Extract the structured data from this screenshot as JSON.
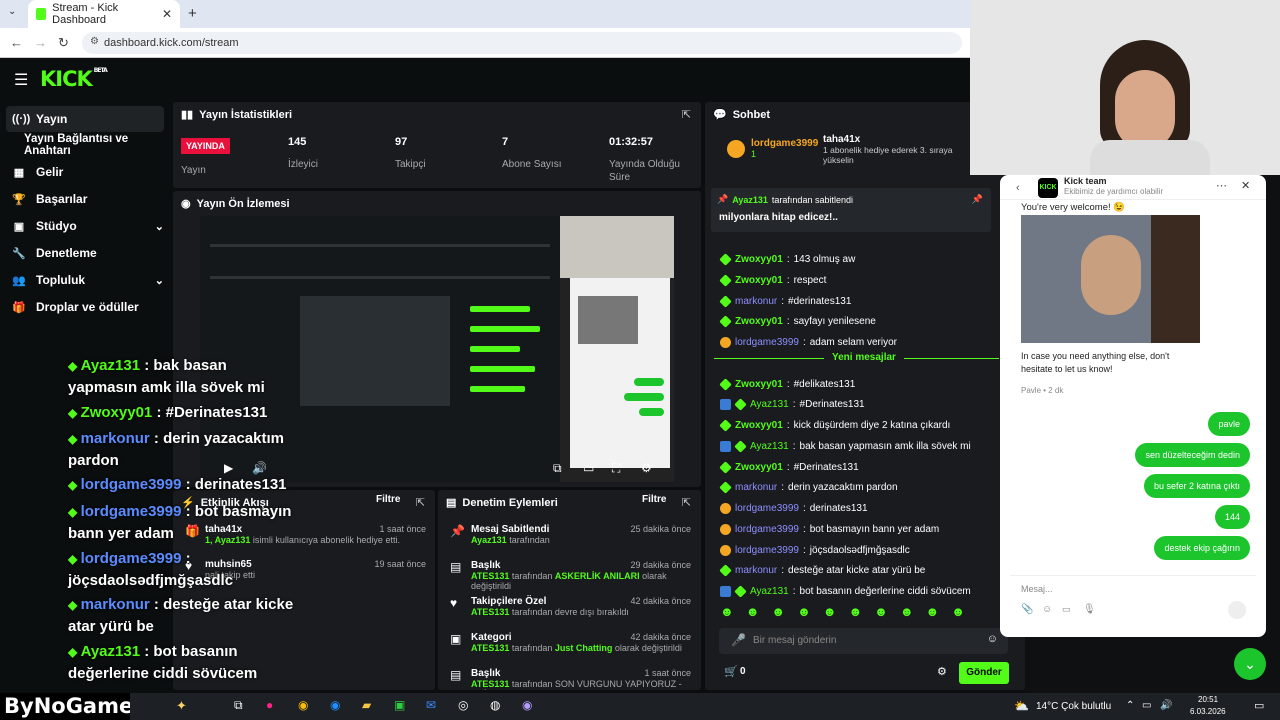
{
  "browser": {
    "tab_title": "Stream - Kick Dashboard",
    "url": "dashboard.kick.com/stream"
  },
  "logo": {
    "text": "KICK",
    "sup": "BETA"
  },
  "sidebar": [
    {
      "label": "Yayın",
      "icon": "broadcast-icon"
    },
    {
      "label": "Yayın Bağlantısı ve Anahtarı",
      "icon": ""
    },
    {
      "label": "Gelir",
      "icon": "chart-icon"
    },
    {
      "label": "Başarılar",
      "icon": "trophy-icon"
    },
    {
      "label": "Stüdyo",
      "icon": "studio-icon"
    },
    {
      "label": "Denetleme",
      "icon": "wrench-icon"
    },
    {
      "label": "Topluluk",
      "icon": "people-icon"
    },
    {
      "label": "Droplar ve ödüller",
      "icon": "gift-icon"
    }
  ],
  "stats": {
    "title": "Yayın İstatistikleri",
    "live_badge": "YAYINDA",
    "live_label": "Yayın",
    "items": [
      {
        "value": "145",
        "label": "İzleyici"
      },
      {
        "value": "97",
        "label": "Takipçi"
      },
      {
        "value": "7",
        "label": "Abone Sayısı"
      },
      {
        "value": "01:32:57",
        "label": "Yayında Olduğu Süre"
      }
    ]
  },
  "preview": {
    "title": "Yayın Ön İzlemesi"
  },
  "activity": {
    "title": "Etkinlik Akışı",
    "filter": "Filtre",
    "rows": [
      {
        "user": "taha41x",
        "desc_name": "1, Ayaz131",
        "desc": " isimli kullanıcıya abonelik hediye etti.",
        "time": "1 saat önce"
      },
      {
        "user": "muhsin65",
        "desc_name": "",
        "desc": "nali takip etti",
        "time": "19 saat önce"
      }
    ]
  },
  "moderation": {
    "title": "Denetim Eylemleri",
    "filter": "Filtre",
    "rows": [
      {
        "title": "Mesaj Sabitlendi",
        "actor": "Ayaz131",
        "rest": " tarafından",
        "extra": "",
        "tail": "",
        "time": "25 dakika önce"
      },
      {
        "title": "Başlık",
        "actor": "ATES131",
        "rest": " tarafından ",
        "extra": "ASKERLİK ANILARI",
        "tail": " olarak değiştirildi",
        "time": "29 dakika önce"
      },
      {
        "title": "Takipçilere Özel",
        "actor": "ATES131",
        "rest": " tarafından devre dışı bırakıldı",
        "extra": "",
        "tail": "",
        "time": "42 dakika önce"
      },
      {
        "title": "Kategori",
        "actor": "ATES131",
        "rest": " tarafından ",
        "extra": "Just Chatting",
        "tail": " olarak değiştirildi",
        "time": "42 dakika önce"
      },
      {
        "title": "Başlık",
        "actor": "ATES131",
        "rest": " tarafından SON VURGUNU YAPIYORUZ - CRİME",
        "extra": "",
        "tail": "",
        "time": "1 saat önce"
      }
    ]
  },
  "chat": {
    "title": "Sohbet",
    "top_user": "lordgame3999",
    "top_user_count": "1",
    "gift_user": "taha41x",
    "gift_text": "1 abonelik hediye ederek 3. sıraya yükselin",
    "pinned_by": "Ayaz131",
    "pinned_suffix": " tarafından sabitlendi",
    "pinned_msg": "milyonlara hitap edicez!..",
    "new_messages": "Yeni mesajlar",
    "messages": [
      {
        "user": "Zwoxyy01",
        "type": "green",
        "text": "143 olmuş aw"
      },
      {
        "user": "Zwoxyy01",
        "type": "green",
        "text": "respect"
      },
      {
        "user": "markonur",
        "type": "blue",
        "text": "#derinates131"
      },
      {
        "user": "Zwoxyy01",
        "type": "green",
        "text": "sayfayı yenilesene"
      },
      {
        "user": "lordgame3999",
        "type": "gold",
        "text": "adam selam veriyor"
      },
      {
        "user": "Zwoxyy01",
        "type": "green",
        "text": "#delikates131"
      },
      {
        "user": "Ayaz131",
        "type": "multi",
        "text": "#Derinates131"
      },
      {
        "user": "Zwoxyy01",
        "type": "green",
        "text": "kick düşürdem diye 2 katına çıkardı"
      },
      {
        "user": "Ayaz131",
        "type": "multi",
        "text": "bak basan yapmasın amk illa sövek mi"
      },
      {
        "user": "Zwoxyy01",
        "type": "green",
        "text": "#Derinates131"
      },
      {
        "user": "markonur",
        "type": "blue",
        "text": "derin yazacaktım pardon"
      },
      {
        "user": "lordgame3999",
        "type": "gold",
        "text": "derinates131"
      },
      {
        "user": "lordgame3999",
        "type": "gold",
        "text": "bot basmayın bann yer adam"
      },
      {
        "user": "lordgame3999",
        "type": "gold",
        "text": "jöçsdaolsədfjmğşasdlc"
      },
      {
        "user": "markonur",
        "type": "blue",
        "text": "desteğe atar kicke atar yürü be"
      },
      {
        "user": "Ayaz131",
        "type": "multi",
        "text": "bot basanın değerlerine ciddi sövücem"
      }
    ],
    "input_placeholder": "Bir mesaj gönderin",
    "viewers": "0",
    "send": "Gönder"
  },
  "overlay": [
    {
      "user": "Ayaz131",
      "color": "green",
      "text": " : bak basan",
      "line2": "yapmasın amk illa sövek mi"
    },
    {
      "user": "Zwoxyy01",
      "color": "green",
      "text": " : #Derinates131",
      "line2": ""
    },
    {
      "user": "markonur",
      "color": "blue",
      "text": " : derin yazacaktım",
      "line2": "pardon"
    },
    {
      "user": "lordgame3999",
      "color": "blue",
      "text": " : derinates131",
      "line2": ""
    },
    {
      "user": "lordgame3999",
      "color": "blue",
      "text": " : bot basmayın",
      "line2": "bann yer adam"
    },
    {
      "user": "lordgame3999",
      "color": "blue",
      "text": " :",
      "line2": "jöçsdaolsədfjmğşasdlc"
    },
    {
      "user": "markonur",
      "color": "blue",
      "text": " : desteğe atar kicke",
      "line2": "atar yürü be"
    },
    {
      "user": "Ayaz131",
      "color": "green",
      "text": " : bot basanın",
      "line2": "değerlerine ciddi sövücem"
    }
  ],
  "support": {
    "name": "Kick team",
    "subtitle": "Ekibimiz de yardımcı olabilir",
    "welcome": "You're very welcome! 😉",
    "followup": "In case you need anything else, don't hesitate to let us know!",
    "meta": "Pavle • 2 dk",
    "user_messages": [
      "pavle",
      "sen düzelteceğim dedin",
      "bu sefer 2 katına çıktı",
      "144",
      "destek ekip çağırın"
    ],
    "input_placeholder": "Mesaj..."
  },
  "watermark": "ByNoGame",
  "taskbar": {
    "weather": "14°C  Çok bulutlu",
    "time": "20:51",
    "date": "6.03.2026"
  }
}
